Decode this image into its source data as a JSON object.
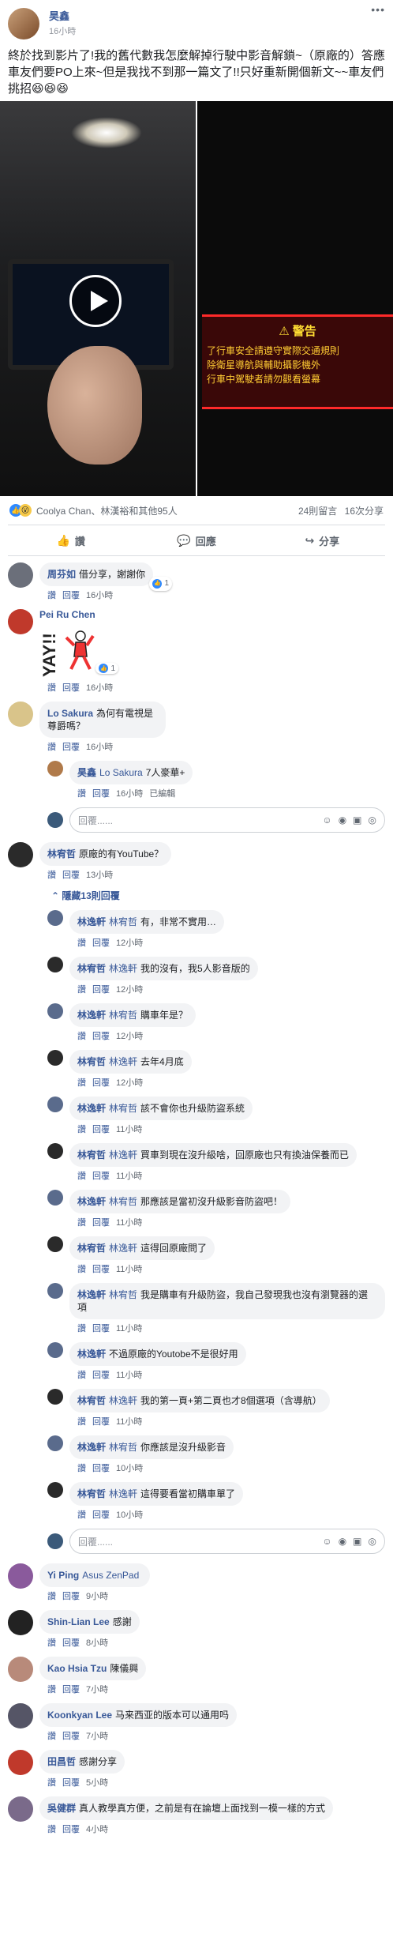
{
  "post": {
    "author": "昊鑫",
    "time": "16小時",
    "text": "終於找到影片了!我的舊代數我怎麼解掉行駛中影音解鎖~（原廠的）答應車友們要PO上來~但是我找不到那一篇文了!!只好重新開個新文~~車友們挑招😆😆😆",
    "media": {
      "warning_title": "⚠ 警告",
      "warning_lines": [
        "了行車安全請遵守實際交通規則",
        "除衛星導航與輔助攝影機外",
        "行車中駕駛者請勿觀看螢幕"
      ]
    },
    "reactions": {
      "summary": "Coolya Chan、林漢裕和其他95人",
      "comments_count": "24則留言",
      "shares_count": "16次分享"
    },
    "actions": {
      "like": "讚",
      "comment": "回應",
      "share": "分享"
    }
  },
  "common": {
    "like_link": "讚",
    "reply_link": "回覆",
    "edited": "已編輯",
    "input_placeholder": "回覆......"
  },
  "comments": [
    {
      "name": "周芬如",
      "text": "借分享，謝謝你",
      "time": "16小時",
      "likes": "1"
    },
    {
      "name": "Pei Ru Chen",
      "text": "",
      "sticker_text": "YAY!!",
      "time": "16小時",
      "likes": "1"
    },
    {
      "name": "Lo Sakura",
      "text": "為何有電視是尊爵嗎？",
      "time": "16小時"
    },
    {
      "name": "林宥哲",
      "text": "原廠的有YouTube？",
      "time": "13小時"
    }
  ],
  "lo_reply": {
    "name": "昊鑫",
    "tag": "Lo Sakura",
    "text": "7人豪華+",
    "time": "16小時"
  },
  "hidden_replies_label": "隱藏13則回覆",
  "thread_replies": [
    {
      "name": "林逸軒",
      "tag": "林宥哲",
      "text": "有，非常不實用…",
      "time": "12小時"
    },
    {
      "name": "林宥哲",
      "tag": "林逸軒",
      "text": "我的沒有，我5人影音版的",
      "time": "12小時"
    },
    {
      "name": "林逸軒",
      "tag": "林宥哲",
      "text": "購車年是？",
      "time": "12小時"
    },
    {
      "name": "林宥哲",
      "tag": "林逸軒",
      "text": "去年4月底",
      "time": "12小時"
    },
    {
      "name": "林逸軒",
      "tag": "林宥哲",
      "text": "該不會你也升級防盜系統",
      "time": "11小時"
    },
    {
      "name": "林宥哲",
      "tag": "林逸軒",
      "text": "買車到現在沒升級啥，回原廠也只有換油保養而已",
      "time": "11小時"
    },
    {
      "name": "林逸軒",
      "tag": "林宥哲",
      "text": "那應該是當初沒升級影音防盜吧！",
      "time": "11小時"
    },
    {
      "name": "林宥哲",
      "tag": "林逸軒",
      "text": "這得回原廠問了",
      "time": "11小時"
    },
    {
      "name": "林逸軒",
      "tag": "林宥哲",
      "text": "我是購車有升級防盜，我自己發現我也沒有瀏覽器的選項",
      "time": "11小時"
    },
    {
      "name": "林逸軒",
      "tag": "",
      "text": "不過原廠的Youtobe不是很好用",
      "time": "11小時"
    },
    {
      "name": "林宥哲",
      "tag": "林逸軒",
      "text": "我的第一頁+第二頁也才8個選項（含導航）",
      "time": "11小時"
    },
    {
      "name": "林逸軒",
      "tag": "林宥哲",
      "text": "你應該是沒升級影音",
      "time": "10小時"
    },
    {
      "name": "林宥哲",
      "tag": "林逸軒",
      "text": "這得要看當初購車單了",
      "time": "10小時"
    }
  ],
  "more_comments": [
    {
      "name": "Yi Ping",
      "tag": "Asus ZenPad",
      "text": "",
      "time": "9小時"
    },
    {
      "name": "Shin-Lian Lee",
      "tag": "",
      "text": "感謝",
      "time": "8小時"
    },
    {
      "name": "Kao Hsia Tzu",
      "tag": "",
      "text": "陳儀興",
      "time": "7小時"
    },
    {
      "name": "Koonkyan Lee",
      "tag": "",
      "text": "马来西亚的版本可以通用吗",
      "time": "7小時"
    },
    {
      "name": "田昌哲",
      "tag": "",
      "text": "感謝分享",
      "time": "5小時"
    },
    {
      "name": "吳健群",
      "tag": "",
      "text": "真人教學真方便，之前是有在論壇上面找到一模一樣的方式",
      "time": "4小時"
    }
  ],
  "colors": {
    "link": "#385898",
    "like": "#2e89ff",
    "bubble": "#f2f3f5"
  }
}
